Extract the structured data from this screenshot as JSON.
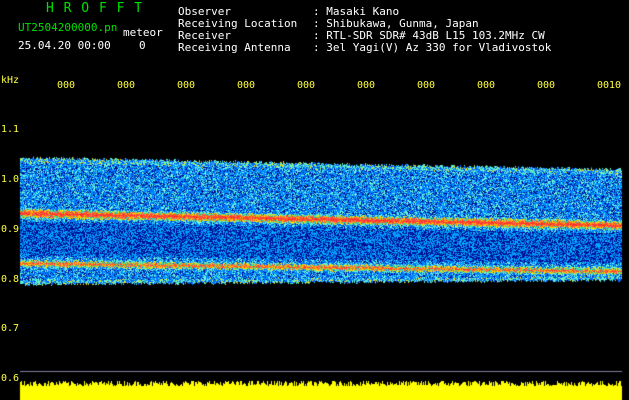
{
  "header": {
    "logo": "H R O F F T",
    "filename": "UT2504200000.pn",
    "mode": "meteor",
    "date": "25.04.20 00:00",
    "index": "0",
    "labels": [
      "Observer",
      "Receiving Location",
      "Receiver",
      "Receiving Antenna"
    ],
    "values": [
      ": Masaki Kano",
      ": Shibukawa, Gunma, Japan",
      ": RTL-SDR SDR# 43dB L15 103.2MHz CW",
      ": 3el Yagi(V) Az 330 for Vladivostok"
    ]
  },
  "axes": {
    "y_unit": "kHz",
    "y_ticks": [
      "1.1",
      "1.0",
      "0.9",
      "0.8",
      "0.7",
      "0.6"
    ],
    "time_ticks": [
      "000",
      "000",
      "000",
      "000",
      "000",
      "000",
      "000",
      "000",
      "000",
      "0010"
    ]
  },
  "colors": {
    "logo": "#00e000",
    "header_text": "#ffffff",
    "axis_text": "#ffff40",
    "background": "#000000",
    "band_low": "#0018c0",
    "band_mid": "#00c8ff",
    "band_high": "#ff2020",
    "signal_bar": "#ffff00"
  }
}
